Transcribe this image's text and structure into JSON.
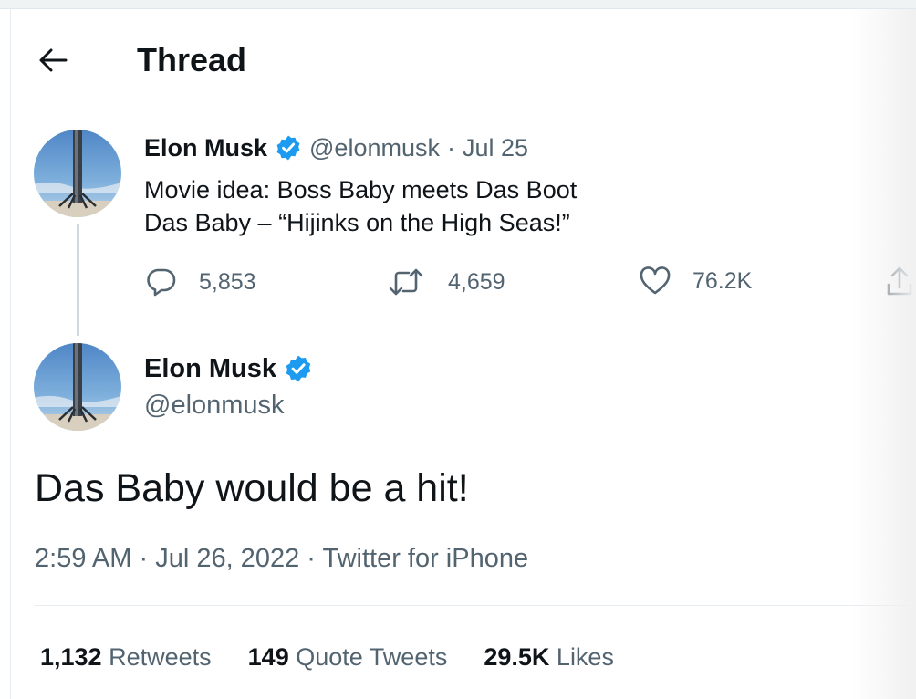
{
  "header": {
    "title": "Thread",
    "back_icon": "arrow-left-icon"
  },
  "colors": {
    "verified": "#1d9bf0",
    "muted": "#536471",
    "text": "#0f1419"
  },
  "parent_tweet": {
    "author_name": "Elon Musk",
    "handle": "@elonmusk",
    "separator": "·",
    "date": "Jul 25",
    "text_lines": [
      "Movie idea: Boss Baby meets Das Boot",
      "Das Baby – “Hijinks on the High Seas!”"
    ],
    "replies": "5,853",
    "retweets": "4,659",
    "likes": "76.2K"
  },
  "main_tweet": {
    "author_name": "Elon Musk",
    "handle": "@elonmusk",
    "text": "Das Baby would be a hit!",
    "time": "2:59 AM",
    "sep1": " · ",
    "date": "Jul 26, 2022",
    "sep2": " · ",
    "source": "Twitter for iPhone",
    "stats": {
      "retweets_count": "1,132",
      "retweets_label": "Retweets",
      "quotes_count": "149",
      "quotes_label": "Quote Tweets",
      "likes_count": "29.5K",
      "likes_label": "Likes"
    }
  }
}
